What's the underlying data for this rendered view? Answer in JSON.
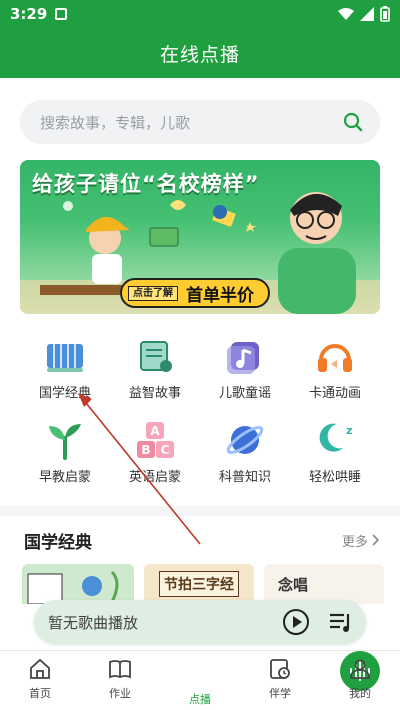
{
  "status_bar": {
    "time": "3:29"
  },
  "app_title": "在线点播",
  "search": {
    "placeholder": "搜索故事，专辑，儿歌"
  },
  "banner": {
    "title": "给孩子请位“名校榜样”",
    "cta_tag": "点击了解",
    "promo": "首单半价"
  },
  "categories": [
    {
      "label": "国学经典",
      "icon": "bamboo-scroll-icon"
    },
    {
      "label": "益智故事",
      "icon": "story-scroll-icon"
    },
    {
      "label": "儿歌童谣",
      "icon": "music-note-icon"
    },
    {
      "label": "卡通动画",
      "icon": "headphones-icon"
    },
    {
      "label": "早教启蒙",
      "icon": "sprout-icon"
    },
    {
      "label": "英语启蒙",
      "icon": "abc-blocks-icon"
    },
    {
      "label": "科普知识",
      "icon": "planet-icon"
    },
    {
      "label": "轻松哄睡",
      "icon": "moon-sleep-icon"
    }
  ],
  "section": {
    "title": "国学经典",
    "more": "更多"
  },
  "albums": [
    {
      "title": "",
      "color": "#cfe9cf"
    },
    {
      "title": "节拍三字经",
      "color": "#f4e6c8"
    },
    {
      "title": "念唱",
      "color": "#f7f3ea"
    }
  ],
  "player": {
    "text": "暂无歌曲播放"
  },
  "tabs": [
    {
      "label": "首页",
      "icon": "home-icon"
    },
    {
      "label": "作业",
      "icon": "book-icon"
    },
    {
      "label": "点播",
      "icon": "audio-wave-icon"
    },
    {
      "label": "伴学",
      "icon": "clock-book-icon"
    },
    {
      "label": "我的",
      "icon": "user-icon"
    }
  ],
  "colors": {
    "brand": "#1f9f3f",
    "annotation_arrow": "#c0392b"
  }
}
